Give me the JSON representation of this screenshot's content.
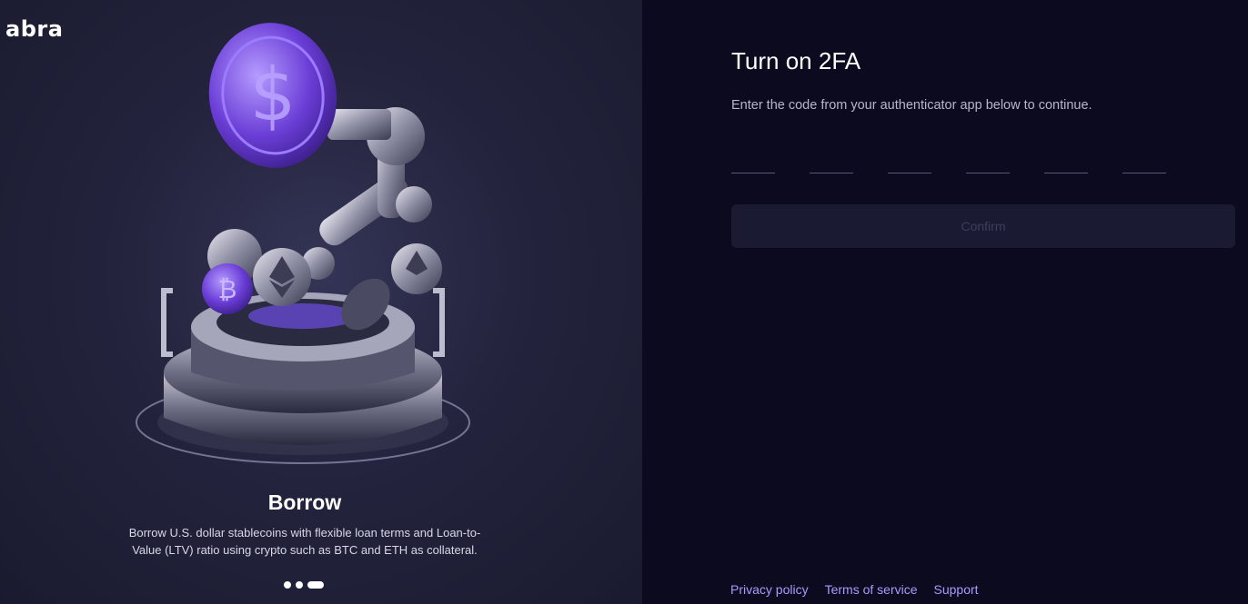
{
  "brand": {
    "logo_text": "abra"
  },
  "carousel": {
    "title": "Borrow",
    "description": "Borrow U.S. dollar stablecoins with flexible loan terms and Loan-to-Value (LTV) ratio using crypto such as BTC and ETH as collateral.",
    "dots": 3,
    "active_index": 2
  },
  "auth": {
    "title": "Turn on 2FA",
    "subtitle": "Enter the code from your authenticator app below to continue.",
    "code_length": 6,
    "code_values": [
      "",
      "",
      "",
      "",
      "",
      ""
    ],
    "confirm_label": "Confirm",
    "confirm_disabled": true
  },
  "footer": {
    "links": [
      "Privacy policy",
      "Terms of service",
      "Support"
    ]
  },
  "colors": {
    "left_bg": "#23233d",
    "right_bg": "#0b0a1e",
    "accent": "#6a3dd6",
    "link": "#a99bff",
    "button_bg": "#1b1a33"
  }
}
